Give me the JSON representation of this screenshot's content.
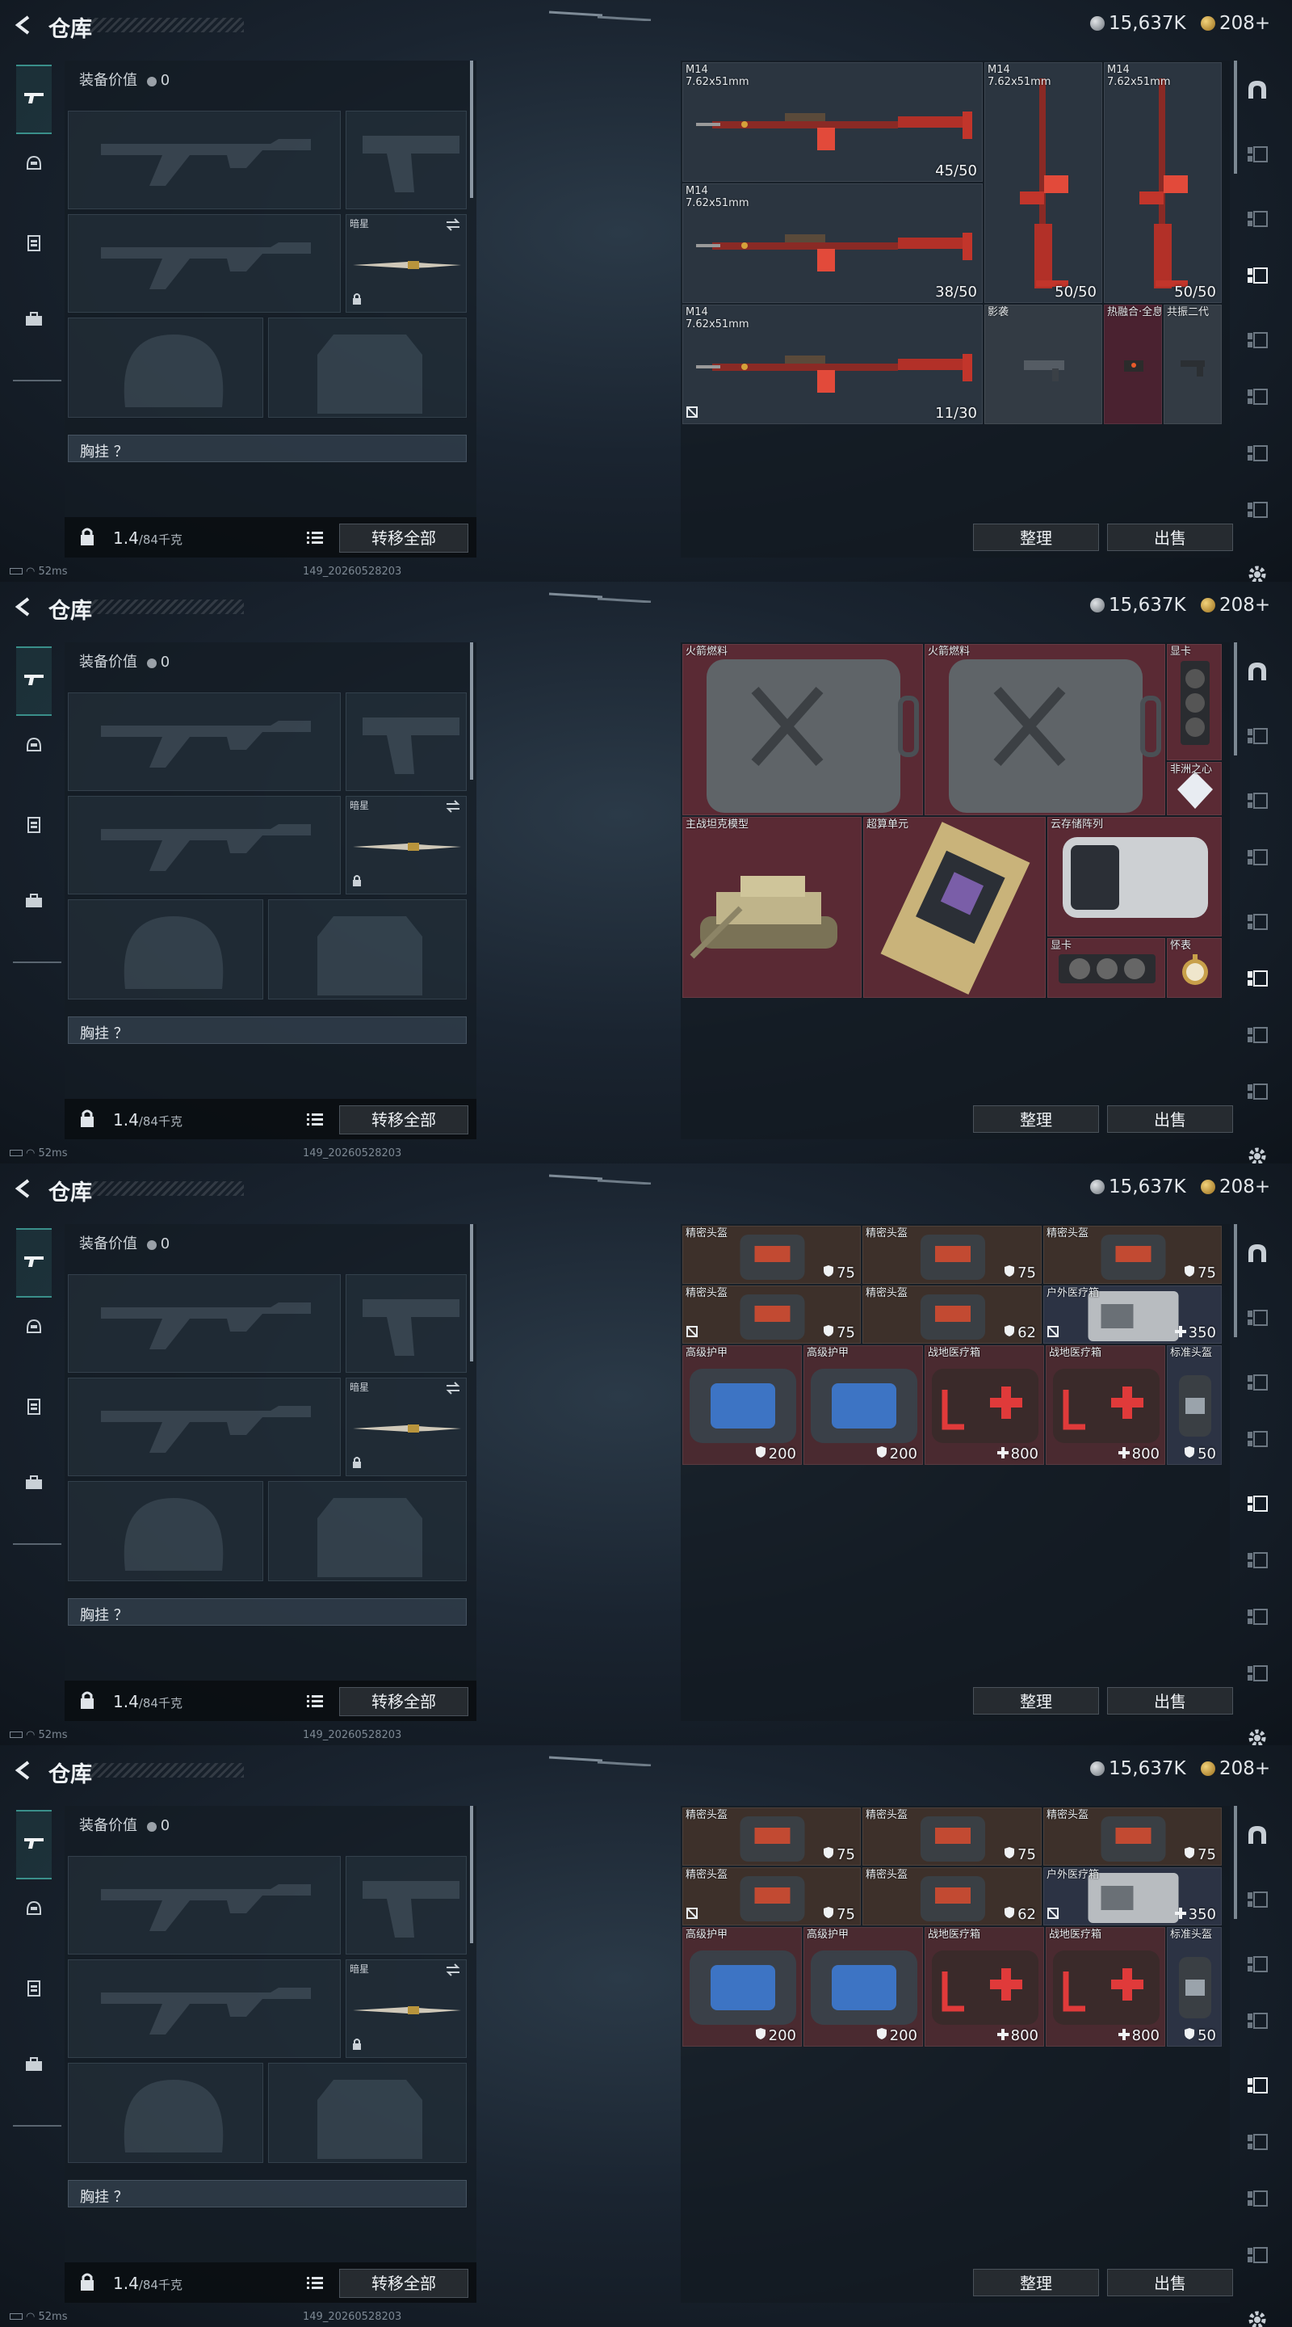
{
  "title": "仓库",
  "currency": {
    "silver": "15,637K",
    "gold": "208+"
  },
  "loadout": {
    "equip_value_label": "装备价值",
    "equip_value": "0",
    "secondary_label": "暗星",
    "chest_rig_label": "胸挂 ？",
    "weight": "1.4",
    "weight_max": "/84千克",
    "transfer_all": "转移全部"
  },
  "status": {
    "ping": "52ms",
    "build": "149_20260528203"
  },
  "actions": {
    "sort": "整理",
    "sell": "出售"
  },
  "left_tabs": [
    "gun-icon",
    "helmet-icon",
    "rig-icon",
    "case-icon"
  ],
  "right_tabs": [
    "arch-icon",
    "weapons-icon",
    "armor-icon",
    "ammo-icon",
    "meds-icon",
    "valuables-icon",
    "keys-icon",
    "misc-icon",
    "settings-icon"
  ],
  "panels": [
    {
      "active_right_tab": 3,
      "cells": [
        {
          "name": "M14",
          "sub": "7.62x51mm",
          "count": "45/50",
          "item": "rifle-h",
          "bg": "#2b3540"
        },
        {
          "name": "M14",
          "sub": "7.62x51mm",
          "count": "50/50",
          "item": "rifle-v",
          "bg": "#2b3540"
        },
        {
          "name": "M14",
          "sub": "7.62x51mm",
          "count": "50/50",
          "item": "rifle-v",
          "bg": "#2b3540"
        },
        {
          "name": "M14",
          "sub": "7.62x51mm",
          "count": "38/50",
          "item": "rifle-h",
          "bg": "#2b3540"
        },
        {
          "name": "M14",
          "sub": "7.62x51mm",
          "count": "11/30",
          "item": "rifle-h",
          "bg": "#2b3540",
          "mark": true
        },
        {
          "name": "影袭",
          "sub": "",
          "count": "",
          "item": "smg",
          "bg": "#333b44"
        },
        {
          "name": "热融合·全息",
          "sub": "",
          "count": "",
          "item": "scope",
          "bg": "#4a2230"
        },
        {
          "name": "共振二代",
          "sub": "",
          "count": "",
          "item": "grip",
          "bg": "#333b44"
        }
      ]
    },
    {
      "active_right_tab": 5,
      "cells": [
        {
          "name": "火箭燃料",
          "count": "",
          "item": "jerrycan",
          "bg": "#5a2a34"
        },
        {
          "name": "火箭燃料",
          "count": "",
          "item": "jerrycan",
          "bg": "#5a2a34"
        },
        {
          "name": "显卡",
          "count": "",
          "item": "gpu-v",
          "bg": "#5a2a34"
        },
        {
          "name": "非洲之心",
          "count": "",
          "item": "gem",
          "bg": "#5a2a34"
        },
        {
          "name": "主战坦克模型",
          "count": "",
          "item": "tank",
          "bg": "#5a2a34"
        },
        {
          "name": "超算单元",
          "count": "",
          "item": "cpu",
          "bg": "#5a2a34"
        },
        {
          "name": "云存储阵列",
          "count": "",
          "item": "storage",
          "bg": "#5a2a34"
        },
        {
          "name": "显卡",
          "count": "",
          "item": "gpu-h",
          "bg": "#5a2a34"
        },
        {
          "name": "怀表",
          "count": "",
          "item": "watch",
          "bg": "#5a2a34"
        }
      ]
    },
    {
      "active_right_tab": 4,
      "cells": [
        {
          "name": "精密头盔",
          "count": "75",
          "item": "helmet",
          "bg": "#3d302a",
          "icon": "shield"
        },
        {
          "name": "精密头盔",
          "count": "75",
          "item": "helmet",
          "bg": "#3d302a",
          "icon": "shield"
        },
        {
          "name": "精密头盔",
          "count": "75",
          "item": "helmet",
          "bg": "#3d302a",
          "icon": "shield"
        },
        {
          "name": "精密头盔",
          "count": "75",
          "item": "helmet",
          "bg": "#3d302a",
          "icon": "shield",
          "mark": true
        },
        {
          "name": "精密头盔",
          "count": "62",
          "item": "helmet",
          "bg": "#3d302a",
          "icon": "shield"
        },
        {
          "name": "户外医疗箱",
          "count": "350",
          "item": "medbox",
          "bg": "#2c3344",
          "icon": "plus",
          "mark": true
        },
        {
          "name": "高级护甲",
          "count": "200",
          "item": "armor",
          "bg": "#4a2a30",
          "icon": "shield"
        },
        {
          "name": "高级护甲",
          "count": "200",
          "item": "armor",
          "bg": "#4a2a30",
          "icon": "shield"
        },
        {
          "name": "战地医疗箱",
          "count": "800",
          "item": "firstaid",
          "bg": "#4a2a30",
          "icon": "plus"
        },
        {
          "name": "战地医疗箱",
          "count": "800",
          "item": "firstaid",
          "bg": "#4a2a30",
          "icon": "plus"
        },
        {
          "name": "标准头盔",
          "count": "50",
          "item": "helmet-s",
          "bg": "#2c3344",
          "icon": "shield"
        }
      ]
    },
    {
      "active_right_tab": 4,
      "cells": [
        {
          "name": "精密头盔",
          "count": "75",
          "item": "helmet",
          "bg": "#3d302a",
          "icon": "shield"
        },
        {
          "name": "精密头盔",
          "count": "75",
          "item": "helmet",
          "bg": "#3d302a",
          "icon": "shield"
        },
        {
          "name": "精密头盔",
          "count": "75",
          "item": "helmet",
          "bg": "#3d302a",
          "icon": "shield"
        },
        {
          "name": "精密头盔",
          "count": "75",
          "item": "helmet",
          "bg": "#3d302a",
          "icon": "shield",
          "mark": true
        },
        {
          "name": "精密头盔",
          "count": "62",
          "item": "helmet",
          "bg": "#3d302a",
          "icon": "shield"
        },
        {
          "name": "户外医疗箱",
          "count": "350",
          "item": "medbox",
          "bg": "#2c3344",
          "icon": "plus",
          "mark": true
        },
        {
          "name": "高级护甲",
          "count": "200",
          "item": "armor",
          "bg": "#4a2a30",
          "icon": "shield"
        },
        {
          "name": "高级护甲",
          "count": "200",
          "item": "armor",
          "bg": "#4a2a30",
          "icon": "shield"
        },
        {
          "name": "战地医疗箱",
          "count": "800",
          "item": "firstaid",
          "bg": "#4a2a30",
          "icon": "plus"
        },
        {
          "name": "战地医疗箱",
          "count": "800",
          "item": "firstaid",
          "bg": "#4a2a30",
          "icon": "plus"
        },
        {
          "name": "标准头盔",
          "count": "50",
          "item": "helmet-s",
          "bg": "#2c3344",
          "icon": "shield"
        }
      ]
    }
  ]
}
